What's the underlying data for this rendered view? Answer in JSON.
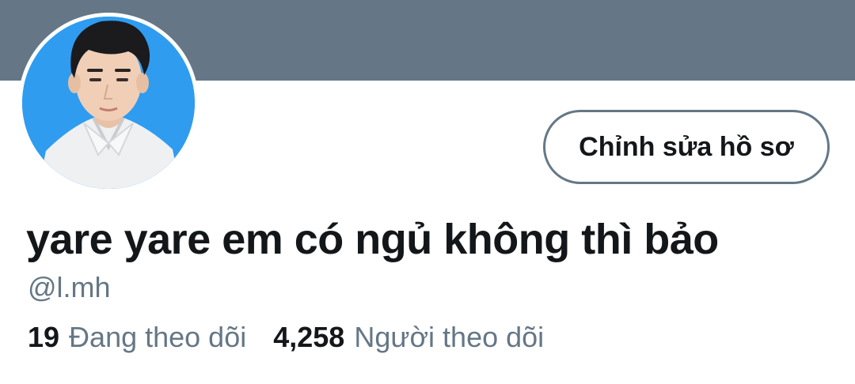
{
  "profile": {
    "edit_button_label": "Chỉnh sửa hồ sơ",
    "display_name": "yare yare em có ngủ không thì bảo",
    "handle": "@l.mh"
  },
  "stats": {
    "following": {
      "count": "19",
      "label": "Đang theo dõi"
    },
    "followers": {
      "count": "4,258",
      "label": "Người theo dõi"
    }
  },
  "colors": {
    "banner": "#657786",
    "avatar_background": "#2f9cf0",
    "primary_text": "#14171a",
    "secondary_text": "#657786"
  }
}
